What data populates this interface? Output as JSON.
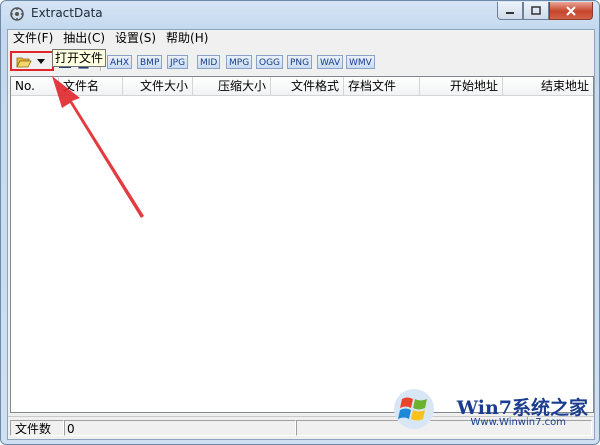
{
  "window": {
    "title": "ExtractData"
  },
  "menu": [
    {
      "label": "文件(F)"
    },
    {
      "label": "抽出(C)"
    },
    {
      "label": "设置(S)"
    },
    {
      "label": "帮助(H)"
    }
  ],
  "toolbar": {
    "formats": [
      "AHX",
      "BMP",
      "JPG",
      "MID",
      "MPG",
      "OGG",
      "PNG",
      "WAV",
      "WMV"
    ]
  },
  "tooltip": "打开文件",
  "list": {
    "columns": [
      "No.",
      "文件名",
      "文件大小",
      "压缩大小",
      "文件格式",
      "存档文件",
      "开始地址",
      "结束地址"
    ]
  },
  "status": {
    "label": "文件数",
    "count": "0"
  },
  "watermark": {
    "brand": "Win7系统之家",
    "url": "Www.Winwin7.com"
  },
  "colors": {
    "accent_red": "#e0262a",
    "titlebar": "#c3d8ee"
  }
}
